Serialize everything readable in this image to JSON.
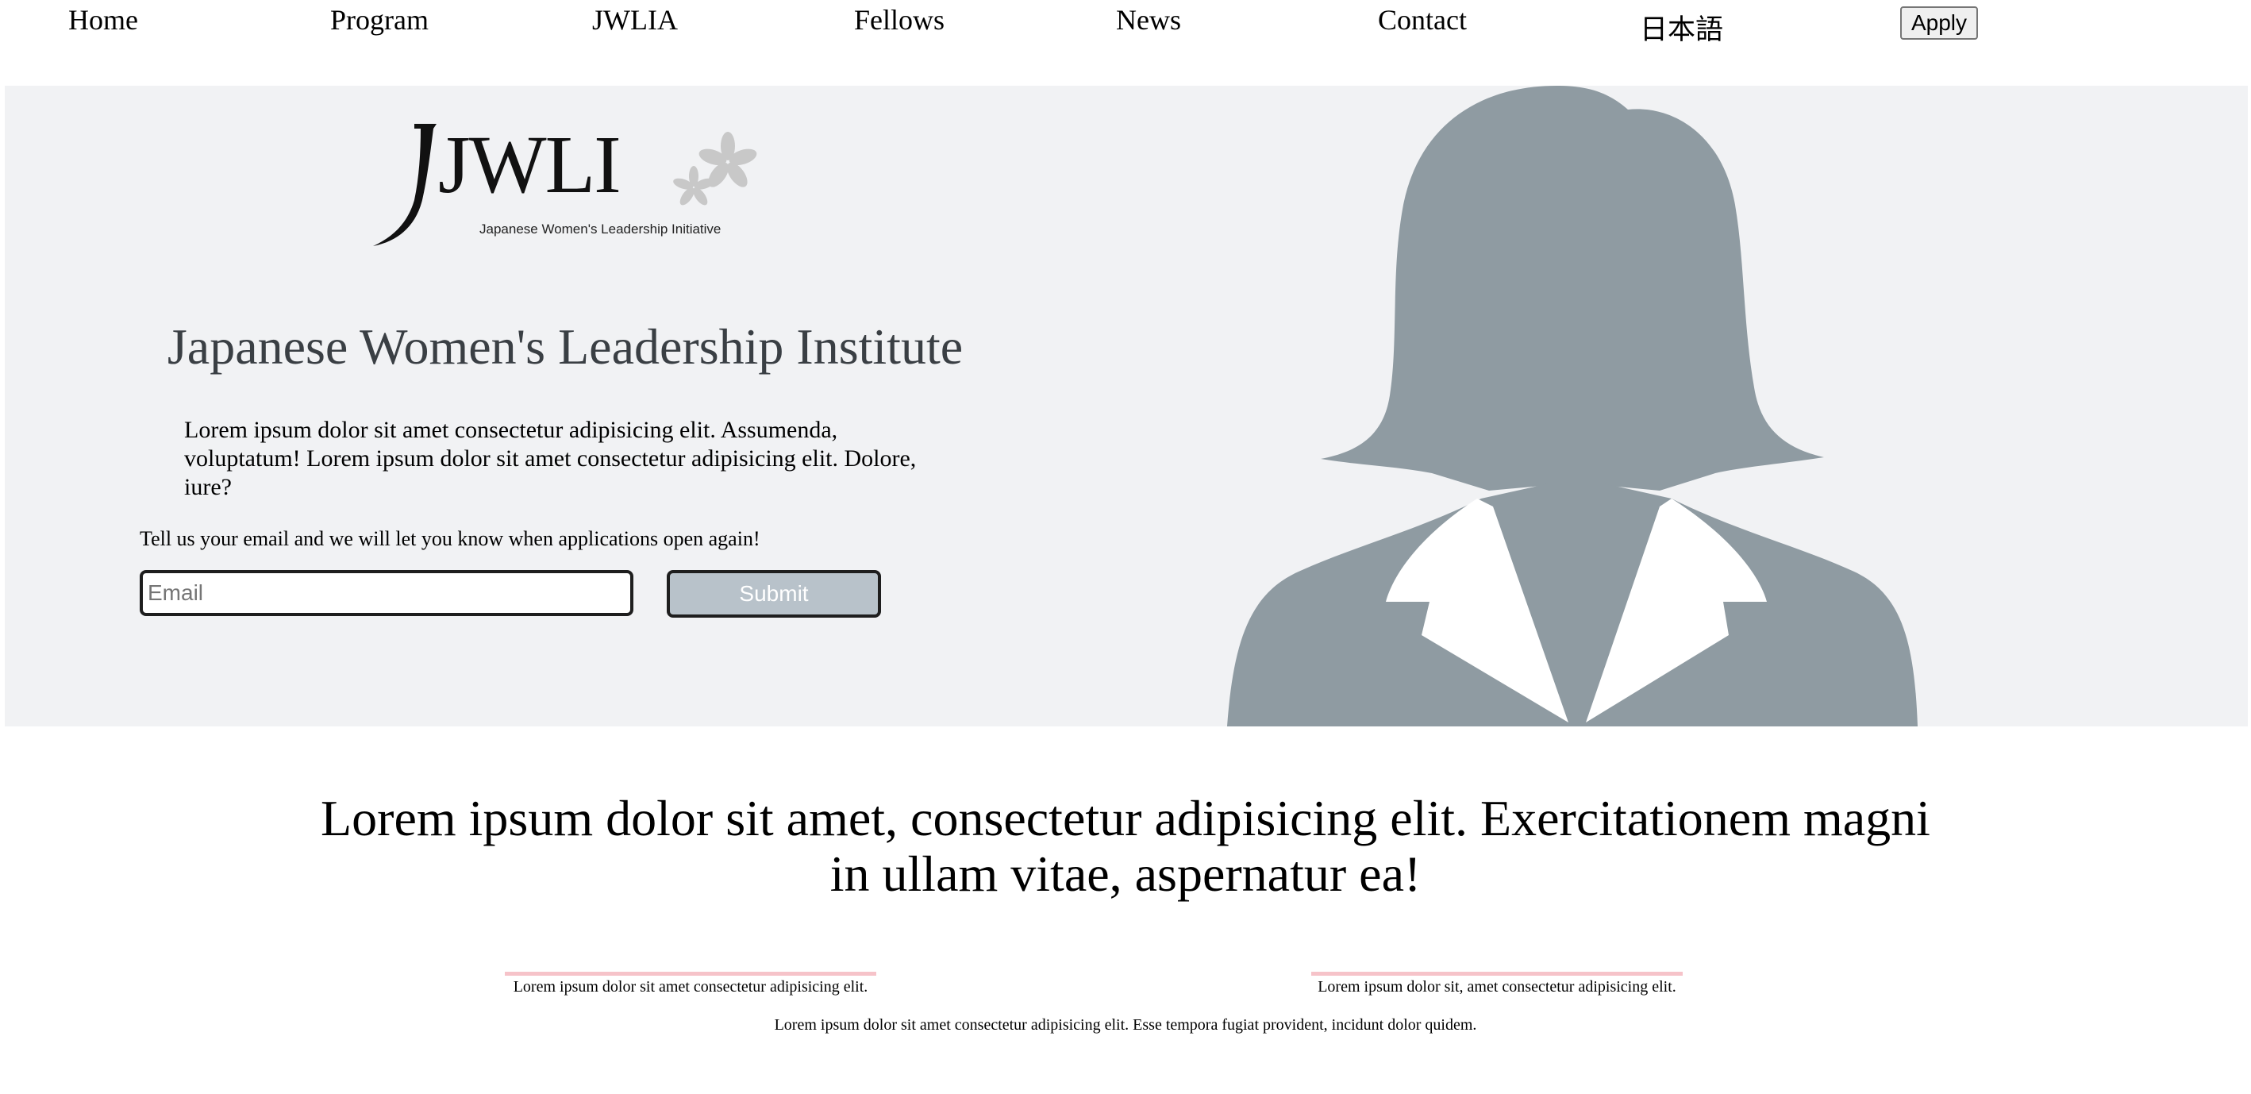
{
  "nav": {
    "links": [
      "Home",
      "Program",
      "JWLIA",
      "Fellows",
      "News",
      "Contact",
      "日本語"
    ],
    "apply_label": "Apply"
  },
  "hero": {
    "logo": {
      "wordmark": "JWLI",
      "tagline": "Japanese Women's Leadership Initiative"
    },
    "title": "Japanese Women's Leadership Institute",
    "description": "Lorem ipsum dolor sit amet consectetur adipisicing elit. Assumenda, voluptatum! Lorem ipsum dolor sit amet consectetur adipisicing elit. Dolore, iure?",
    "email_prompt": "Tell us your email and we will let you know when applications open again!",
    "email_placeholder": "Email",
    "submit_label": "Submit",
    "image_icon": "woman-silhouette-icon"
  },
  "content": {
    "lead": "Lorem ipsum dolor sit amet, consectetur adipisicing elit. Exercitationem magni in ullam vitae, aspernatur ea!",
    "cards": [
      "Lorem ipsum dolor sit amet consectetur adipisicing elit.",
      "Lorem ipsum dolor sit, amet consectetur adipisicing elit."
    ],
    "footnote": "Lorem ipsum dolor sit amet consectetur adipisicing elit. Esse tempora fugiat provident, incidunt dolor quidem."
  },
  "colors": {
    "hero_bg": "#f1f2f4",
    "title_text": "#3a3f44",
    "silhouette": "#8f9ba2",
    "submit_bg": "#b8c2ca",
    "card_accent": "#f6c3c9"
  }
}
